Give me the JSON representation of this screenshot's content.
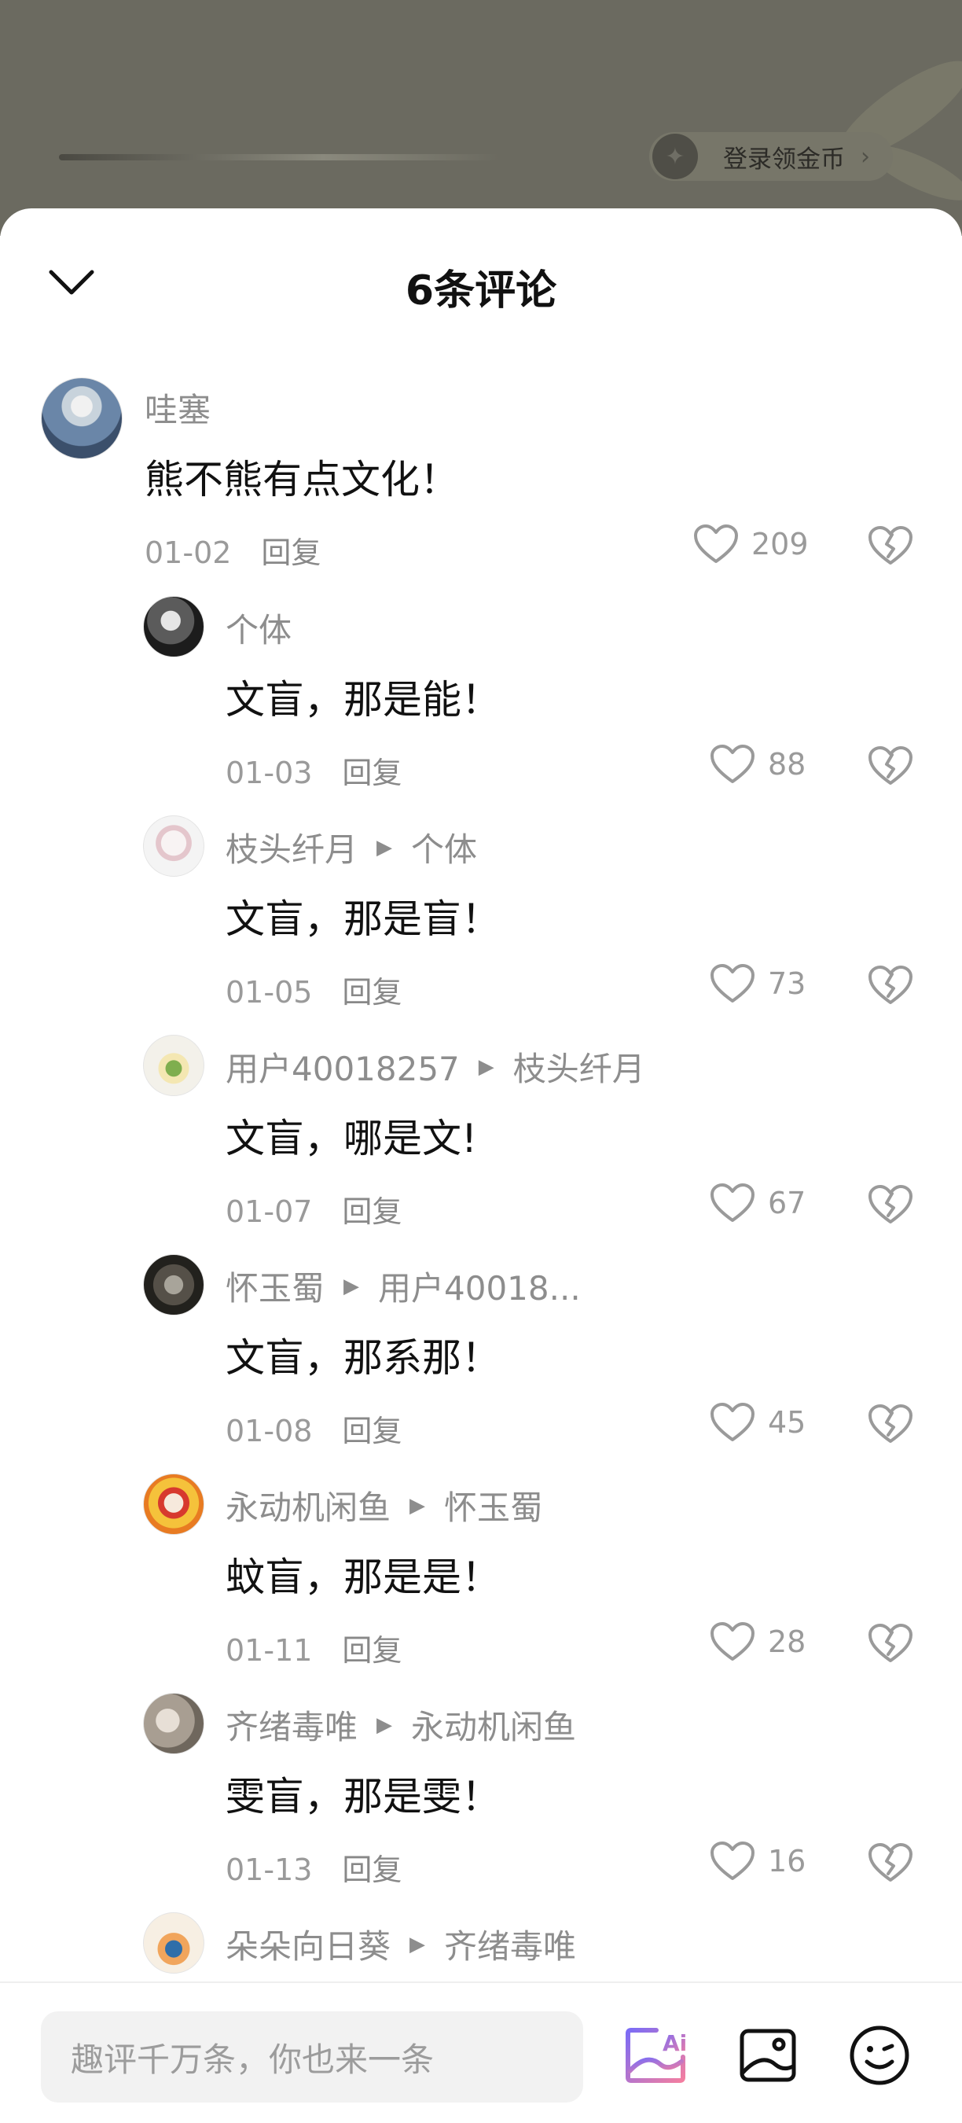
{
  "banner": {
    "coin_label": "登录领金币",
    "coin_chevron": "›"
  },
  "sheet": {
    "title": "6条评论",
    "close_icon": "chevron-down-icon"
  },
  "comments": [
    {
      "user": "哇塞",
      "reply_to": "",
      "text": "熊不熊有点文化！",
      "date": "01-02",
      "reply_label": "回复",
      "likes": "209"
    },
    {
      "user": "个体",
      "reply_to": "",
      "text": "文盲，那是能！",
      "date": "01-03",
      "reply_label": "回复",
      "likes": "88"
    },
    {
      "user": "枝头纤月",
      "reply_to": "个体",
      "text": "文盲，那是盲！",
      "date": "01-05",
      "reply_label": "回复",
      "likes": "73"
    },
    {
      "user": "用户40018257",
      "reply_to": "枝头纤月",
      "text": "文盲，哪是文!",
      "date": "01-07",
      "reply_label": "回复",
      "likes": "67"
    },
    {
      "user": "怀玉蜀",
      "reply_to": "用户40018...",
      "text": "文盲，那系那！",
      "date": "01-08",
      "reply_label": "回复",
      "likes": "45"
    },
    {
      "user": "永动机闲鱼",
      "reply_to": "怀玉蜀",
      "text": "蚊盲，那是是！",
      "date": "01-11",
      "reply_label": "回复",
      "likes": "28"
    },
    {
      "user": "齐绪毒唯",
      "reply_to": "永动机闲鱼",
      "text": "雯盲，那是雯！",
      "date": "01-13",
      "reply_label": "回复",
      "likes": "16"
    },
    {
      "user": "朵朵向日葵",
      "reply_to": "齐绪毒唯",
      "text": "",
      "date": "",
      "reply_label": "",
      "likes": ""
    }
  ],
  "input": {
    "placeholder": "趣评千万条，你也来一条"
  },
  "icons": {
    "ai": "ai-icon",
    "image": "image-icon",
    "emoji": "emoji-icon",
    "like": "heart-icon",
    "dislike": "broken-heart-icon"
  },
  "colors": {
    "accent_ai_start": "#7b6cf6",
    "accent_ai_end": "#f37ea0",
    "text_primary": "#111111",
    "text_secondary": "#8d8d8d"
  }
}
